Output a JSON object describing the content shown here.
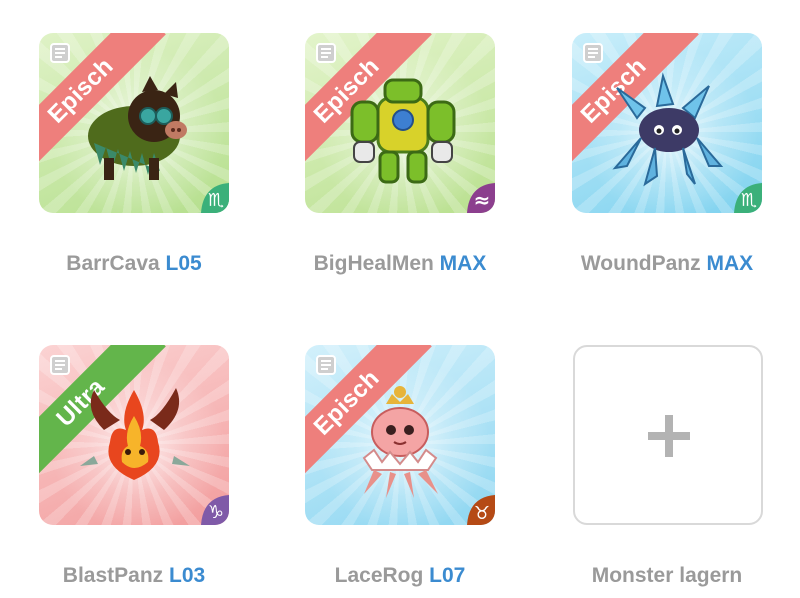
{
  "monsters": [
    {
      "name": "BarrCava",
      "level": "L05",
      "rarity": "Episch",
      "card_color": "#bfe59a",
      "element_icon": "scorpio-icon",
      "element_symbol": "♏",
      "element_color": "#3bb07a"
    },
    {
      "name": "BigHealMen",
      "level": "MAX",
      "rarity": "Episch",
      "card_color": "#c4e89c",
      "element_icon": "waves-icon",
      "element_symbol": "≈",
      "element_color": "#8c3f8e"
    },
    {
      "name": "WoundPanz",
      "level": "MAX",
      "rarity": "Episch",
      "card_color": "#8fd8f0",
      "element_icon": "scorpio-icon",
      "element_symbol": "♏",
      "element_color": "#3bb07a"
    },
    {
      "name": "BlastPanz",
      "level": "L03",
      "rarity": "Ultra",
      "card_color": "#f2a3a3",
      "element_icon": "capricorn-icon",
      "element_symbol": "♑",
      "element_color": "#7f5aa8"
    },
    {
      "name": "LaceRog",
      "level": "L07",
      "rarity": "Episch",
      "card_color": "#9fdcf2",
      "element_icon": "taurus-icon",
      "element_symbol": "♉",
      "element_color": "#b54a15"
    }
  ],
  "store_slot": {
    "label": "Monster lagern",
    "icon": "plus-icon"
  }
}
